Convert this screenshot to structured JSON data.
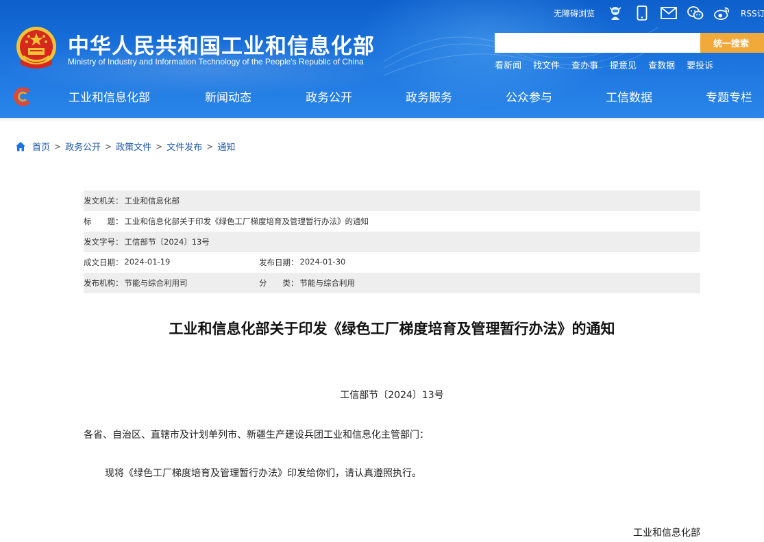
{
  "header": {
    "site_title": "中华人民共和国工业和信息化部",
    "site_subtitle": "Ministry of Industry and Information Technology of the People's Republic of China",
    "accessible_label": "无障碍浏览",
    "rss_label": "RSS订阅",
    "search": {
      "placeholder": "",
      "button_label": "统一搜索"
    },
    "quick_links": [
      "看新闻",
      "找文件",
      "查办事",
      "提意见",
      "查数据",
      "要投诉"
    ],
    "nav_items": [
      "工业和信息化部",
      "新闻动态",
      "政务公开",
      "政务服务",
      "公众参与",
      "工信数据",
      "专题专栏"
    ],
    "icons": [
      "emblem-icon",
      "robot-icon",
      "mobile-icon",
      "mail-icon",
      "wechat-icon",
      "weibo-icon",
      "nav-logo-icon"
    ],
    "colors": {
      "header_blue": "#1a72dc",
      "search_orange": "#f1a93a",
      "link_blue": "#1b57a8"
    }
  },
  "breadcrumb": [
    "首页",
    "政务公开",
    "政策文件",
    "文件发布",
    "通知"
  ],
  "meta": {
    "issuer_label": "发文机关：",
    "issuer": "工业和信息化部",
    "title_label": "标　　题：",
    "title": "工业和信息化部关于印发《绿色工厂梯度培育及管理暂行办法》的通知",
    "doc_no_label": "发文字号：",
    "doc_no": "工信部节〔2024〕13号",
    "written_date_label": "成文日期：",
    "written_date": "2024-01-19",
    "publish_date_label": "发布日期：",
    "publish_date": "2024-01-30",
    "org_label": "发布机构：",
    "org": "节能与综合利用司",
    "category_label": "分　　类：",
    "category": "节能与综合利用"
  },
  "document": {
    "title": "工业和信息化部关于印发《绿色工厂梯度培育及管理暂行办法》的通知",
    "number": "工信部节〔2024〕13号",
    "recipients": "各省、自治区、直辖市及计划单列市、新疆生产建设兵团工业和信息化主管部门：",
    "body": "现将《绿色工厂梯度培育及管理暂行办法》印发给你们，请认真遵照执行。",
    "signature": "工业和信息化部"
  }
}
